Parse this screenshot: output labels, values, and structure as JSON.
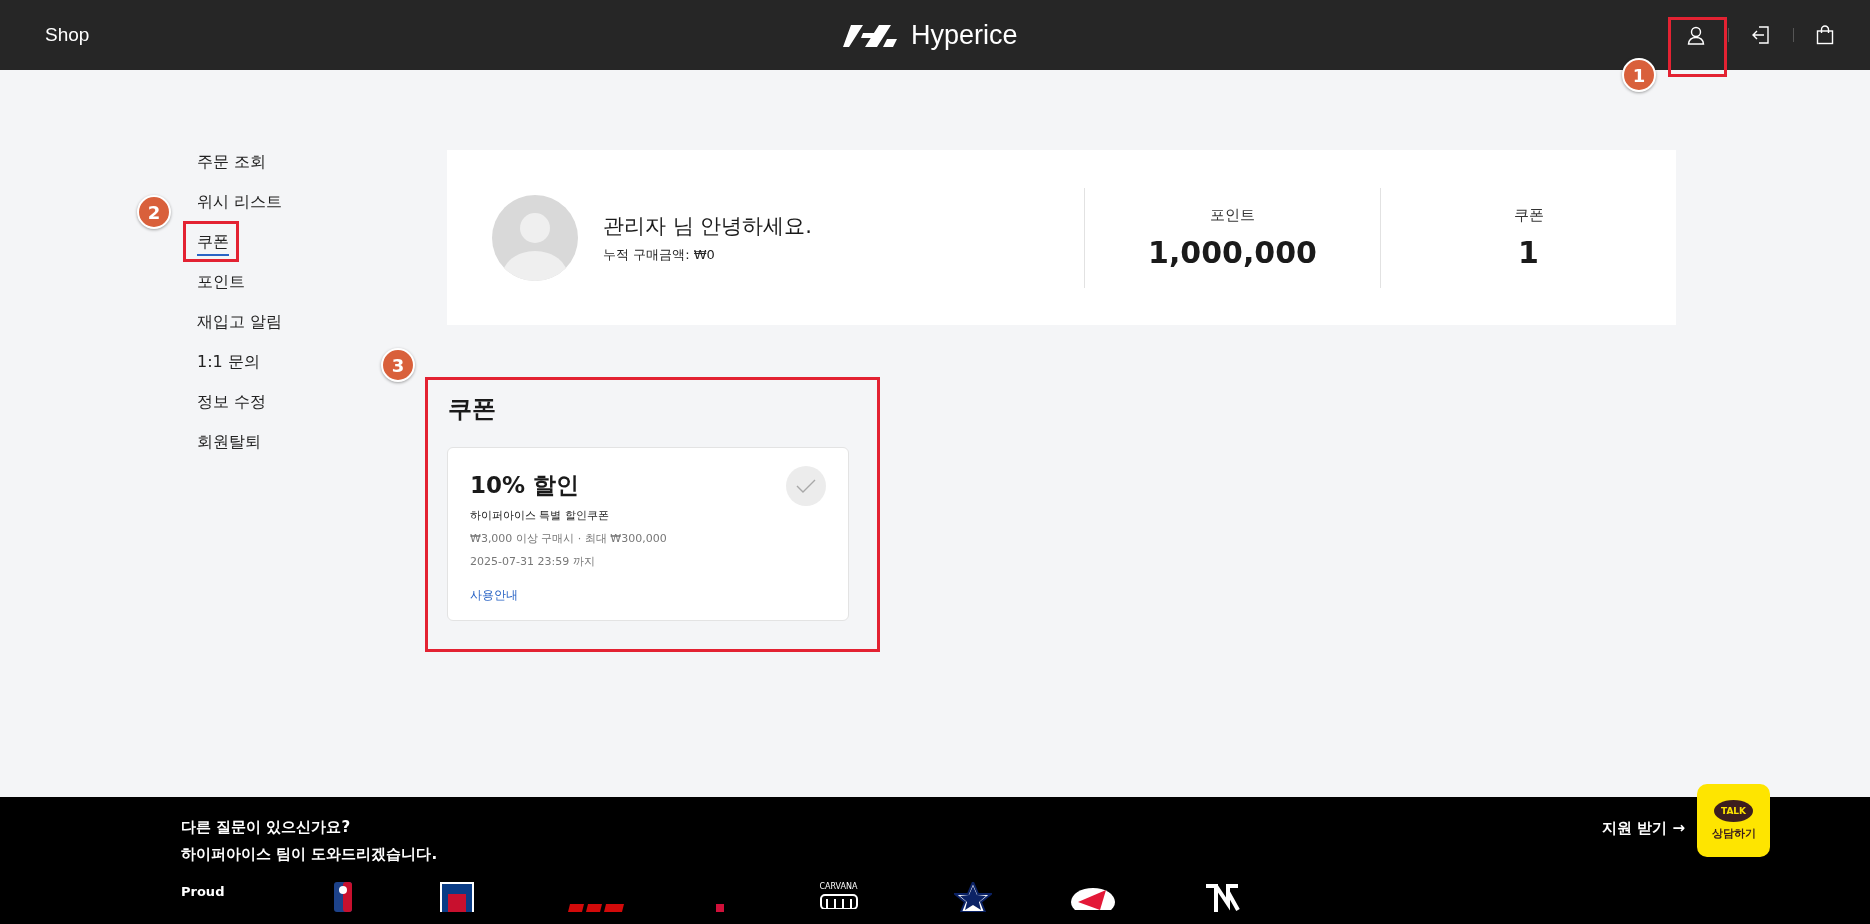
{
  "header": {
    "shop_link": "Shop",
    "brand": "Hyperice"
  },
  "sidebar": {
    "items": [
      {
        "label": "주문 조회",
        "selected": false
      },
      {
        "label": "위시 리스트",
        "selected": false
      },
      {
        "label": "쿠폰",
        "selected": true
      },
      {
        "label": "포인트",
        "selected": false
      },
      {
        "label": "재입고 알림",
        "selected": false
      },
      {
        "label": "1:1 문의",
        "selected": false
      },
      {
        "label": "정보 수정",
        "selected": false
      },
      {
        "label": "회원탈퇴",
        "selected": false
      }
    ]
  },
  "profile": {
    "greeting": "관리자 님 안녕하세요.",
    "total_purchase": "누적 구매금액: ₩0",
    "stats": [
      {
        "label": "포인트",
        "value": "1,000,000"
      },
      {
        "label": "쿠폰",
        "value": "1"
      }
    ]
  },
  "coupon_section": {
    "title": "쿠폰",
    "coupons": [
      {
        "title": "10% 할인",
        "name": "하이퍼아이스 특별 할인쿠폰",
        "condition": "₩3,000 이상 구매시 · 최대 ₩300,000",
        "expiry": "2025-07-31 23:59 까지",
        "guide_link": "사용안내",
        "checked": false
      }
    ]
  },
  "footer": {
    "question": "다른 질문이 있으신가요?",
    "help_text": "하이퍼아이스 팀이 도와드리겠습니다.",
    "support_link": "지원 받기 →",
    "chat_button": {
      "badge": "TALK",
      "label": "상담하기"
    },
    "partners_label": "Proud",
    "partner_caption": "CARVANA"
  },
  "annotations": [
    {
      "label": "1"
    },
    {
      "label": "2"
    },
    {
      "label": "3"
    }
  ]
}
